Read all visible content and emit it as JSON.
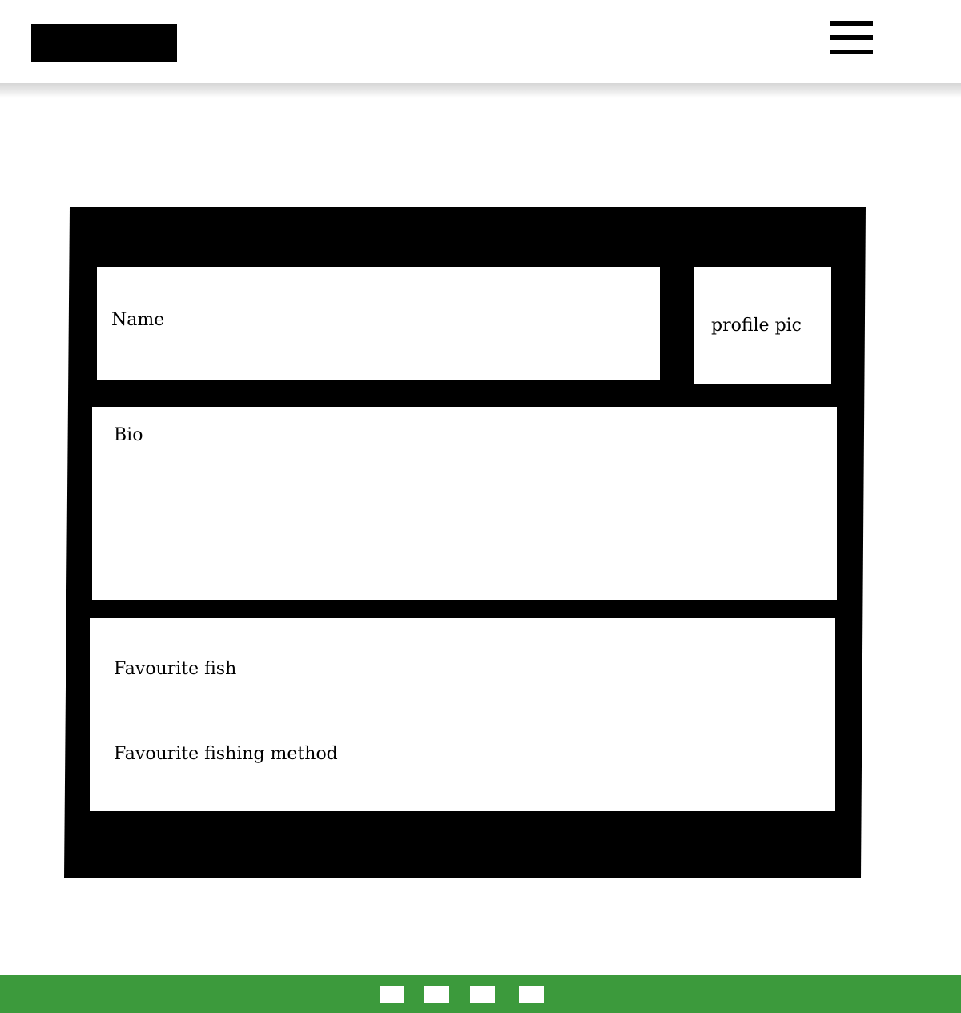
{
  "header": {
    "logo": "logo-block",
    "menu_icon": "hamburger-menu-icon"
  },
  "profile": {
    "name_label": "Name",
    "profile_pic_label": "profile pic",
    "bio_label": "Bio",
    "favourite_fish_label": "Favourite fish",
    "favourite_method_label": "Favourite fishing method"
  },
  "footer": {
    "background_color": "#3c9a3c",
    "buttons": [
      "nav-button-1",
      "nav-button-2",
      "nav-button-3",
      "nav-button-4"
    ]
  }
}
